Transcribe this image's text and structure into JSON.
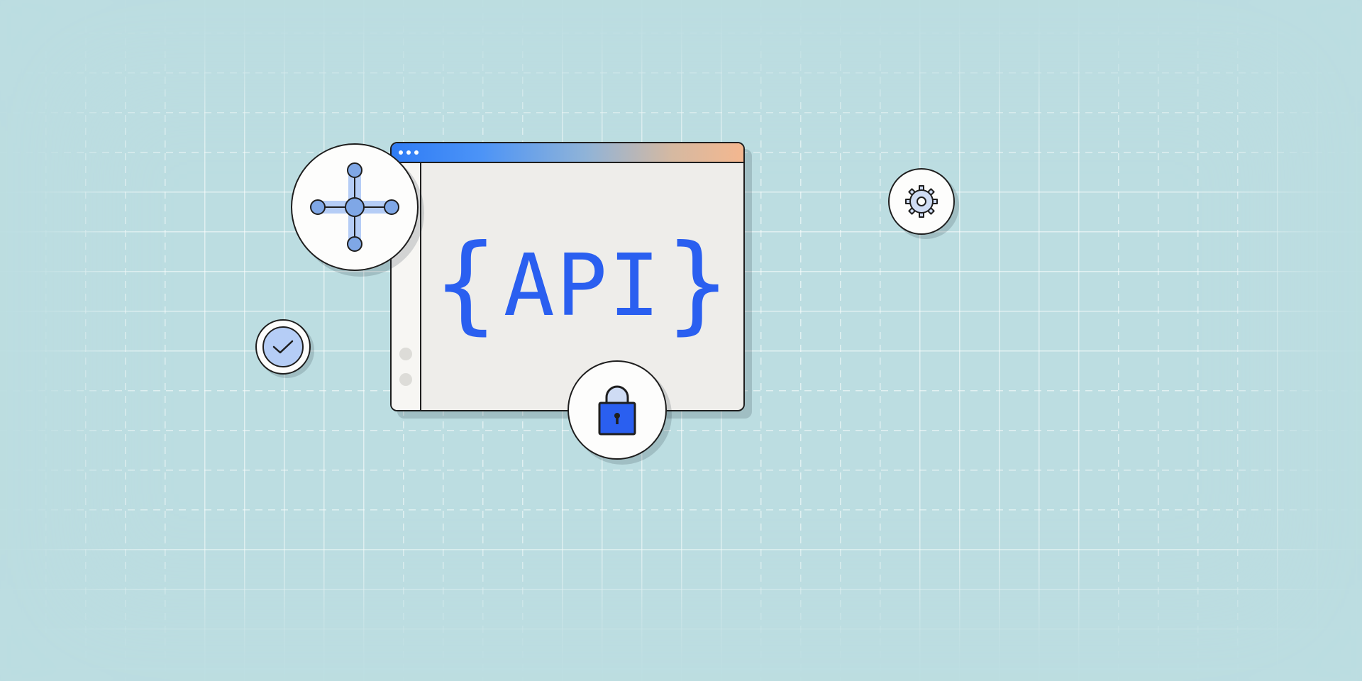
{
  "window": {
    "text_left_brace": "{",
    "text_label": "API",
    "text_right_brace": "}"
  },
  "icons": {
    "nodes": "nodes-icon",
    "gear": "gear-icon",
    "check": "check-icon",
    "lock": "lock-icon"
  },
  "colors": {
    "background": "#bcdde1",
    "accent": "#2a5ff0",
    "surface": "#eeedea",
    "outline": "#1e1e1e"
  }
}
